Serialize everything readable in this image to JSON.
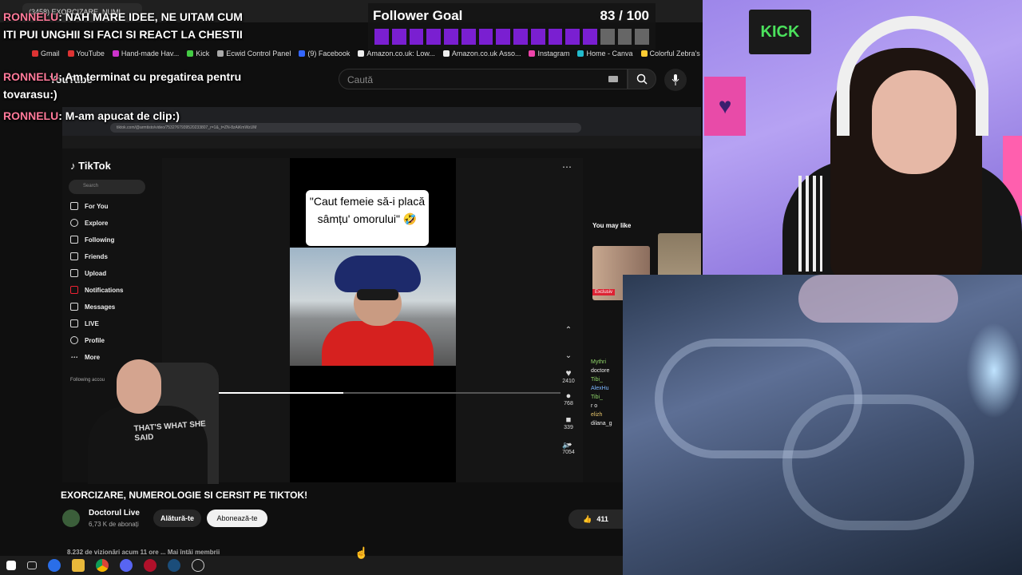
{
  "browser": {
    "tab_title": "(3458) EXORCIZARE, NUMI",
    "bookmarks": [
      "Gmail",
      "YouTube",
      "Hand-made Hav...",
      "Kick",
      "Ecwid Control Panel",
      "(9) Facebook",
      "Amazon.co.uk: Low...",
      "Amazon.co.uk Asso...",
      "Instagram",
      "Home - Canva",
      "Colorful Zebra's Ma..."
    ]
  },
  "youtube": {
    "logo": "YouTube",
    "search_placeholder": "Caută"
  },
  "tiktok": {
    "url": "tiktok.com/@armtisto/video/7532767939520233807_r=1&_t=ZN-8zAiKmWzUM",
    "logo": "TikTok",
    "search_placeholder": "Search",
    "nav": [
      "For You",
      "Explore",
      "Following",
      "Friends",
      "Upload",
      "Notifications",
      "Messages",
      "LIVE",
      "Profile",
      "More"
    ],
    "following_accounts": "Following accou",
    "caption": "\"Caut femeie să-i placă sâmțu' omorului\" 🤣",
    "likes": "2410",
    "comments": "768",
    "saves": "339",
    "shares": "7054",
    "you_may_like": "You may like",
    "exclusiv": "Exclusiv",
    "mini_chat": [
      "Mythri",
      "doctore",
      "Tibi_",
      "AlexHu",
      "Tibi_",
      "r o",
      "elizh",
      "dilana_g"
    ]
  },
  "streamer_shirt": "THAT'S WHAT SHE SAID",
  "video": {
    "title": "EXORCIZARE, NUMEROLOGIE SI CERSIT PE TIKTOK!",
    "channel": "Doctorul Live",
    "subscribers": "6,73 K de abonați",
    "join_label": "Alătură-te",
    "subscribe_label": "Abonează-te",
    "likes": "411",
    "views_line": "8.232 de vizionări  acum 11 ore  ... Mai întâi membrii"
  },
  "follower_goal": {
    "label": "Follower Goal",
    "count": "83 / 100",
    "progress_fraction": 0.83,
    "color": "#7a1fd1"
  },
  "chat": [
    {
      "user": "RONNELU",
      "text": ": NAH MARE IDEE, NE UITAM CUM ITI PUI UNGHII SI FACI SI REACT LA CHESTII"
    },
    {
      "user": "RONNELU",
      "text": ": Am terminat cu pregatirea pentru tovarasu:)"
    },
    {
      "user": "RONNELU",
      "text": ": M-am apucat de clip:)"
    }
  ],
  "kick_sign": "KICK"
}
